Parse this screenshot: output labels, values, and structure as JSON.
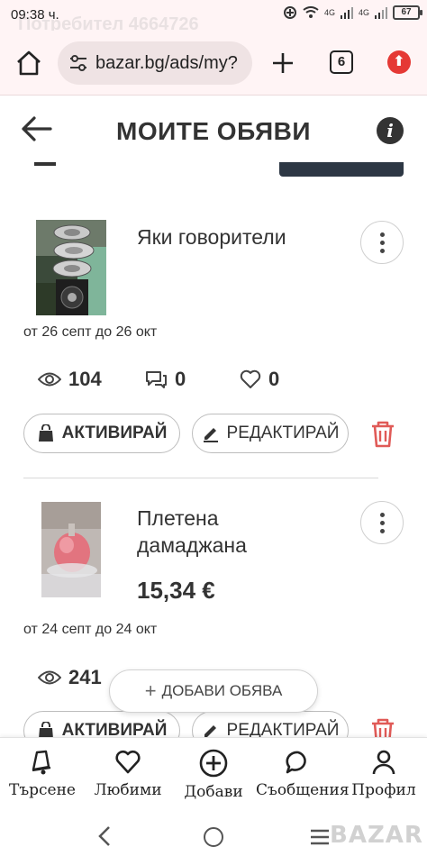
{
  "status_bar": {
    "time": "09:38 ч.",
    "ghost_text": "Потребител 4664726",
    "network": "4G",
    "network2": "4G",
    "battery": "67"
  },
  "browser": {
    "url": "bazar.bg/ads/my?",
    "tab_count": "6",
    "icons": [
      "home-icon",
      "site-settings-icon",
      "new-tab-icon",
      "tab-switcher-icon",
      "update-icon"
    ]
  },
  "header": {
    "title": "МОИТЕ ОБЯВИ",
    "info": "i"
  },
  "listings": [
    {
      "title": "Яки говорители",
      "price": "",
      "dates": "от 26 септ до 26 окт",
      "views": "104",
      "messages": "0",
      "favorites": "0",
      "activate_label": "АКТИВИРАЙ",
      "edit_label": "РЕДАКТИРАЙ"
    },
    {
      "title_line1": "Плетена",
      "title_line2": "дамаджана",
      "price": "15,34 €",
      "dates": "от 24 септ до 24 окт",
      "views": "241",
      "activate_label": "АКТИВИРАЙ",
      "edit_label": "РЕДАКТИРАЙ"
    }
  ],
  "float_button": {
    "label": "ДОБАВИ ОБЯВА",
    "plus": "+"
  },
  "bottom_nav": {
    "items": [
      {
        "label": "Търсене",
        "icon": "bell-search-icon"
      },
      {
        "label": "Любими",
        "icon": "heart-icon"
      },
      {
        "label": "Добави",
        "icon": "add-circle-icon"
      },
      {
        "label": "Съобщения",
        "icon": "chat-icon"
      },
      {
        "label": "Профил",
        "icon": "profile-icon"
      }
    ]
  },
  "watermark": "BAZAR",
  "colors": {
    "accent_red": "#e05a57",
    "browser_bg": "#fff4f5",
    "dark_button": "#2d3744",
    "text": "#333333"
  }
}
